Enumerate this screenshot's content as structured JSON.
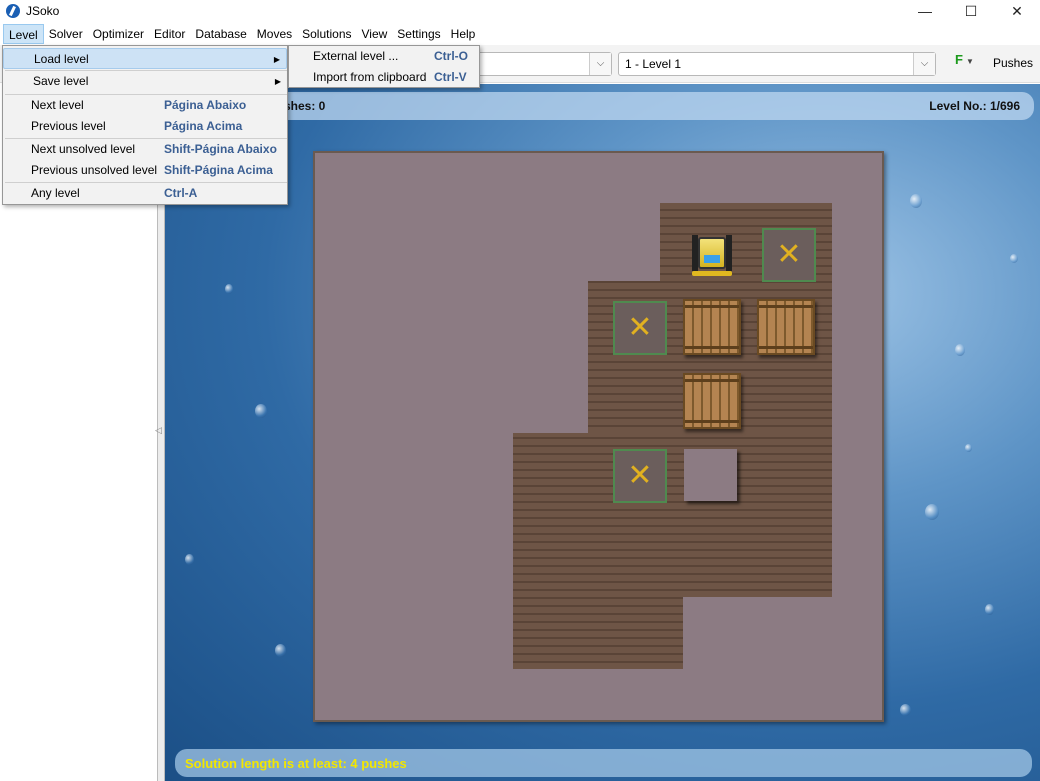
{
  "window": {
    "title": "JSoko",
    "minimize_icon": "minimize-icon",
    "maximize_icon": "maximize-icon",
    "close_icon": "close-icon"
  },
  "menubar": [
    "Level",
    "Solver",
    "Optimizer",
    "Editor",
    "Database",
    "Moves",
    "Solutions",
    "View",
    "Settings",
    "Help"
  ],
  "toolbar": {
    "collection_combo_value": "",
    "level_combo_value": "1 - Level 1",
    "pushes_label": "Pushes"
  },
  "level_menu": {
    "items": [
      {
        "label": "Load level",
        "accel": "",
        "submenu": true
      },
      {
        "label": "Save level",
        "accel": "",
        "submenu": true
      },
      {
        "label": "Next level",
        "accel": "Página Abaixo"
      },
      {
        "label": "Previous level",
        "accel": "Página Acima"
      },
      {
        "label": "Next unsolved level",
        "accel": "Shift-Página Abaixo"
      },
      {
        "label": "Previous unsolved level",
        "accel": "Shift-Página Acima"
      },
      {
        "label": "Any level",
        "accel": "Ctrl-A"
      }
    ]
  },
  "load_submenu": {
    "items": [
      {
        "label": "External level ...",
        "accel": "Ctrl-O"
      },
      {
        "label": "Import from clipboard",
        "accel": "Ctrl-V"
      }
    ]
  },
  "status": {
    "moves_partial": "shes: 0",
    "level_no": "Level No.: 1/696",
    "solution_length": "Solution length is at least:  4 pushes"
  },
  "colors": {
    "menu_highlight": "#cde2f5",
    "accelerator": "#3b5f93",
    "solution_text": "#f2e600"
  }
}
